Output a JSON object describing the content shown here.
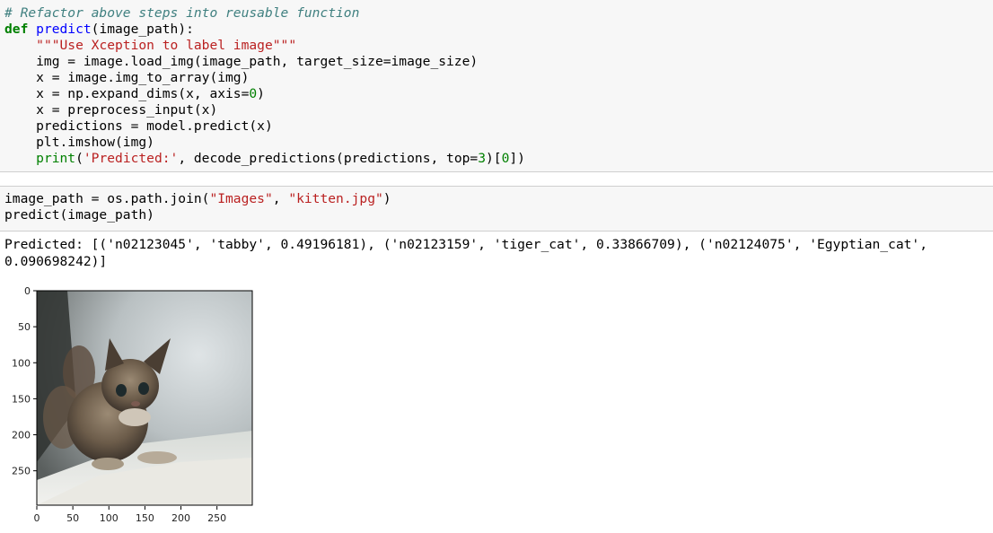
{
  "cell1": {
    "lines": [
      [
        {
          "c": "cm",
          "t": "# Refactor above steps into reusable function"
        }
      ],
      [
        {
          "c": "kw",
          "t": "def "
        },
        {
          "c": "fn",
          "t": "predict"
        },
        {
          "c": "op",
          "t": "(image_path):"
        }
      ],
      [
        {
          "c": "op",
          "t": "    "
        },
        {
          "c": "st",
          "t": "\"\"\"Use Xception to label image\"\"\""
        }
      ],
      [
        {
          "c": "op",
          "t": "    img = image.load_img(image_path, target_size=image_size)"
        }
      ],
      [
        {
          "c": "op",
          "t": "    x = image.img_to_array(img)"
        }
      ],
      [
        {
          "c": "op",
          "t": "    x = np.expand_dims(x, axis="
        },
        {
          "c": "nm",
          "t": "0"
        },
        {
          "c": "op",
          "t": ")"
        }
      ],
      [
        {
          "c": "op",
          "t": "    x = preprocess_input(x)"
        }
      ],
      [
        {
          "c": "op",
          "t": "    predictions = model.predict(x)"
        }
      ],
      [
        {
          "c": "op",
          "t": "    plt.imshow(img)"
        }
      ],
      [
        {
          "c": "op",
          "t": "    "
        },
        {
          "c": "bi",
          "t": "print"
        },
        {
          "c": "op",
          "t": "("
        },
        {
          "c": "st",
          "t": "'Predicted:'"
        },
        {
          "c": "op",
          "t": ", decode_predictions(predictions, top="
        },
        {
          "c": "nm",
          "t": "3"
        },
        {
          "c": "op",
          "t": ")["
        },
        {
          "c": "nm",
          "t": "0"
        },
        {
          "c": "op",
          "t": "])"
        }
      ]
    ]
  },
  "cell2": {
    "lines": [
      [
        {
          "c": "op",
          "t": "image_path = os.path.join("
        },
        {
          "c": "st",
          "t": "\"Images\""
        },
        {
          "c": "op",
          "t": ", "
        },
        {
          "c": "st",
          "t": "\"kitten.jpg\""
        },
        {
          "c": "op",
          "t": ")"
        }
      ],
      [
        {
          "c": "op",
          "t": "predict(image_path)"
        }
      ]
    ]
  },
  "output": {
    "line1": "Predicted: [('n02123045', 'tabby', 0.49196181), ('n02123159', 'tiger_cat', 0.33866709), ('n02124075', 'Egyptian_cat',",
    "line2": "0.090698242)]"
  },
  "plot": {
    "x_ticks": [
      "0",
      "50",
      "100",
      "150",
      "200",
      "250"
    ],
    "y_ticks": [
      "0",
      "50",
      "100",
      "150",
      "200",
      "250"
    ]
  },
  "colors": {
    "comment": "#408080",
    "keyword": "#008000",
    "function": "#0000ff",
    "string": "#ba2121",
    "cell_background": "#f7f7f7"
  }
}
